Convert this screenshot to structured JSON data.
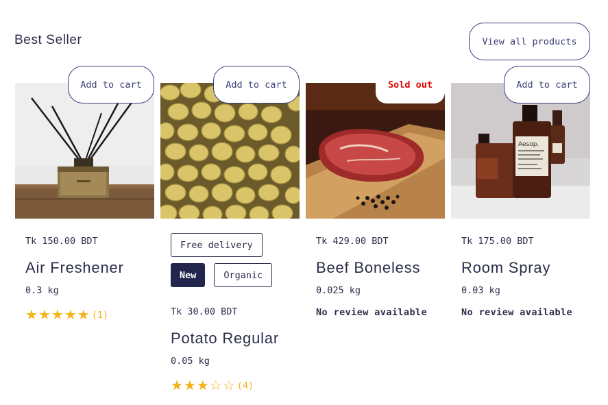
{
  "section": {
    "title": "Best Seller",
    "view_all_label": "View all products"
  },
  "colors": {
    "primary": "#2b2d4a",
    "accent_star": "#f6b21c",
    "sold_out": "#e10000",
    "badge_new_bg": "#22264e"
  },
  "products": [
    {
      "image_icon": "reed-diffuser-image",
      "action_label": "Add to cart",
      "price": "Tk 150.00 BDT",
      "name": "Air Freshener",
      "weight": "0.3 kg",
      "rating": 5,
      "review_count": "(1)"
    },
    {
      "image_icon": "potatoes-image",
      "action_label": "Add to cart",
      "tags": [
        "Free delivery",
        "New",
        "Organic"
      ],
      "price": "Tk 30.00 BDT",
      "name": "Potato Regular",
      "weight": "0.05 kg",
      "rating": 3,
      "review_count": "(4)"
    },
    {
      "image_icon": "beef-steak-image",
      "status_label": "Sold out",
      "price": "Tk 429.00 BDT",
      "name": "Beef Boneless",
      "weight": "0.025 kg",
      "review_text": "No review available"
    },
    {
      "image_icon": "spray-bottles-image",
      "action_label": "Add to cart",
      "price": "Tk 175.00 BDT",
      "name": "Room Spray",
      "weight": "0.03 kg",
      "review_text": "No review available",
      "image_text": "Aesop."
    }
  ]
}
